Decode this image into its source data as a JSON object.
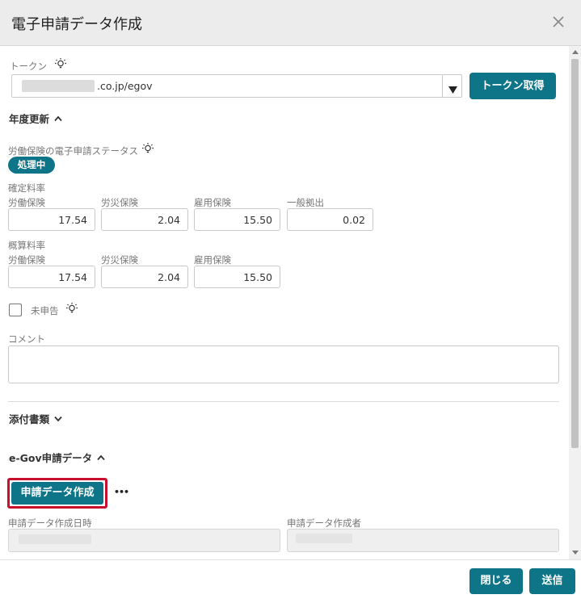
{
  "dialog": {
    "title": "電子申請データ作成"
  },
  "token": {
    "label": "トークン",
    "select_value": ".co.jp/egov",
    "get_button": "トークン取得"
  },
  "annual_update": {
    "heading": "年度更新",
    "status_label": "労働保険の電子申請ステータス",
    "status_badge": "処理中",
    "confirmed_rate": {
      "heading": "確定料率",
      "fields": [
        {
          "label": "労働保険",
          "value": "17.54"
        },
        {
          "label": "労災保険",
          "value": "2.04"
        },
        {
          "label": "雇用保険",
          "value": "15.50"
        },
        {
          "label": "一般拠出",
          "value": "0.02"
        }
      ]
    },
    "estimated_rate": {
      "heading": "概算料率",
      "fields": [
        {
          "label": "労働保険",
          "value": "17.54"
        },
        {
          "label": "労災保険",
          "value": "2.04"
        },
        {
          "label": "雇用保険",
          "value": "15.50"
        }
      ]
    },
    "unfiled_label": "未申告",
    "comment_label": "コメント"
  },
  "attachments": {
    "heading": "添付書類"
  },
  "egov": {
    "heading": "e-Gov申請データ",
    "create_button": "申請データ作成",
    "more": "•••",
    "created_at_label": "申請データ作成日時",
    "created_by_label": "申請データ作成者"
  },
  "footer": {
    "close_button": "閉じる",
    "send_button": "送信"
  },
  "colors": {
    "accent": "#0e7588",
    "highlight_border": "#c8102e"
  },
  "icons": [
    "close-icon",
    "lightbulb-icon",
    "chevron-up-icon",
    "chevron-down-icon",
    "dropdown-triangle-icon",
    "checkbox-icon"
  ]
}
